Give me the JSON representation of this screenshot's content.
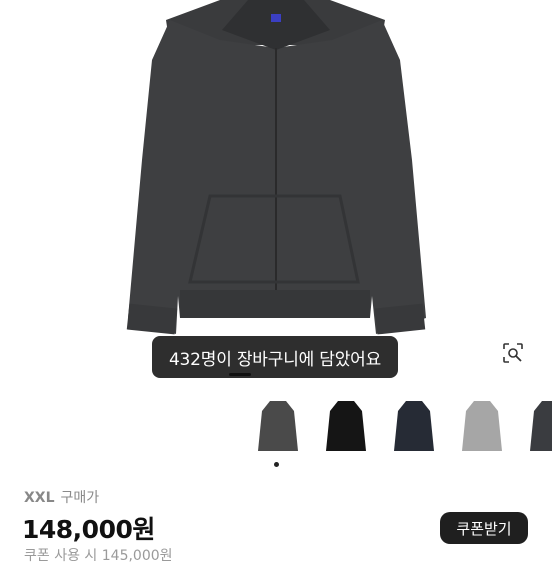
{
  "product": {
    "toast": "432명이 장바구니에 담았어요",
    "size": "XXL",
    "purchase_label": "구매가",
    "price": "148,000원",
    "coupon_button": "쿠폰받기",
    "cut_line": "쿠폰 사용 시 145,000원"
  },
  "icons": {
    "lens": "image-search-icon"
  },
  "thumbnails": [
    {
      "color": "#4a4a4a",
      "selected": true
    },
    {
      "color": "#151515",
      "selected": false
    },
    {
      "color": "#262b35",
      "selected": false
    },
    {
      "color": "#a6a6a6",
      "selected": false
    },
    {
      "color": "#3a3c40",
      "selected": false
    }
  ],
  "colors": {
    "hoodie": "#3e3f41",
    "toast_bg": "#1c1c1c",
    "price_text": "#111111",
    "coupon_bg": "#1f1f1f"
  }
}
